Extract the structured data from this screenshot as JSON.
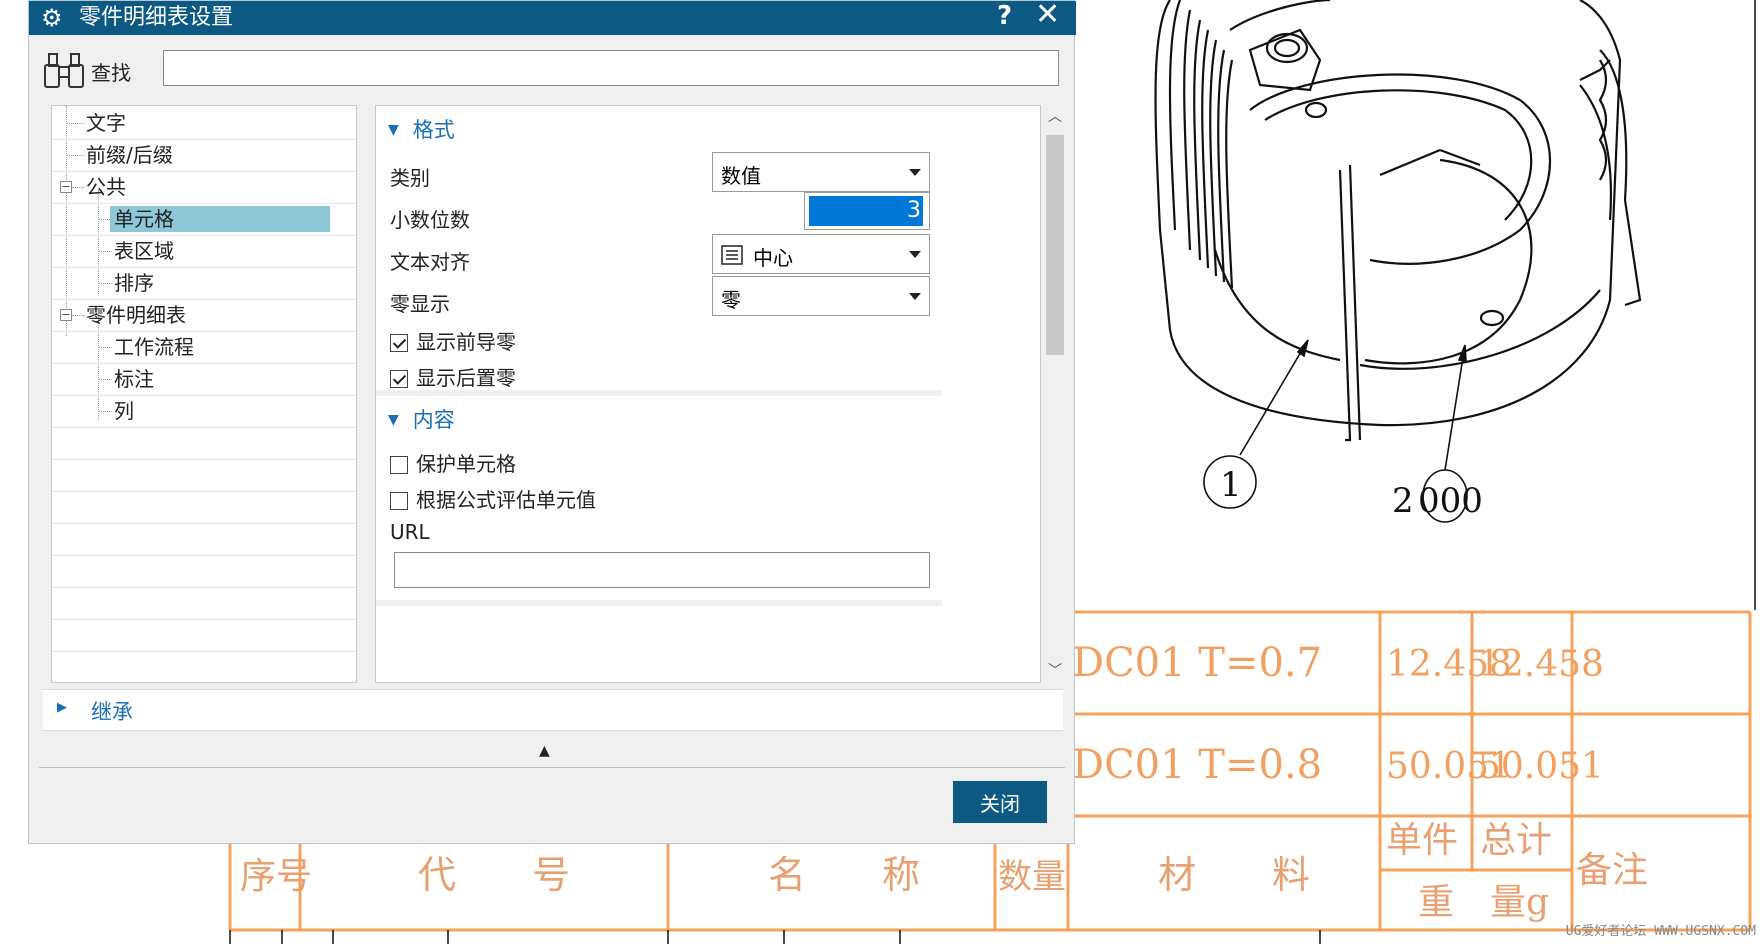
{
  "dialog": {
    "title": "零件明细表设置",
    "help": "?",
    "close_glyph": "✕"
  },
  "search": {
    "label": "查找",
    "value": ""
  },
  "tree": {
    "items": [
      {
        "label": "文字",
        "level": 1
      },
      {
        "label": "前缀/后缀",
        "level": 1
      },
      {
        "label": "公共",
        "level": 1,
        "expander": "−"
      },
      {
        "label": "单元格",
        "level": 2,
        "selected": true
      },
      {
        "label": "表区域",
        "level": 2
      },
      {
        "label": "排序",
        "level": 2
      },
      {
        "label": "零件明细表",
        "level": 1,
        "expander": "−"
      },
      {
        "label": "工作流程",
        "level": 2
      },
      {
        "label": "标注",
        "level": 2
      },
      {
        "label": "列",
        "level": 2
      }
    ]
  },
  "format": {
    "header": "格式",
    "category_label": "类别",
    "category_value": "数值",
    "decimals_label": "小数位数",
    "decimals_value": "3",
    "align_label": "文本对齐",
    "align_value": "中心",
    "zero_label": "零显示",
    "zero_value": "零",
    "leading_zero_label": "显示前导零",
    "leading_zero_checked": true,
    "trailing_zero_label": "显示后置零",
    "trailing_zero_checked": true
  },
  "content": {
    "header": "内容",
    "protect_label": "保护单元格",
    "protect_checked": false,
    "formula_label": "根据公式评估单元值",
    "formula_checked": false,
    "url_label": "URL",
    "url_value": ""
  },
  "inherit": {
    "label": "继承"
  },
  "footer": {
    "close_label": "关闭"
  },
  "drawing": {
    "balloon_1": "1",
    "balloon_2": "2",
    "balloon_2_suffix": "000",
    "bom_rows": [
      {
        "material": "DC01 T=0.7",
        "unit": "12.458",
        "total": "12.458"
      },
      {
        "material": "DC01 T=0.8",
        "unit": "50.051",
        "total": "50.051"
      }
    ],
    "header": {
      "seq": "序号",
      "code": "代　　号",
      "name": "名　　称",
      "qty": "数量",
      "material": "材　　料",
      "unit_w": "单件",
      "total_w": "总计",
      "weight": "重　量g",
      "remark": "备注"
    },
    "watermark": "UG爱好者论坛 WWW.UGSNX.COM",
    "line_color": "#f5a35a"
  }
}
